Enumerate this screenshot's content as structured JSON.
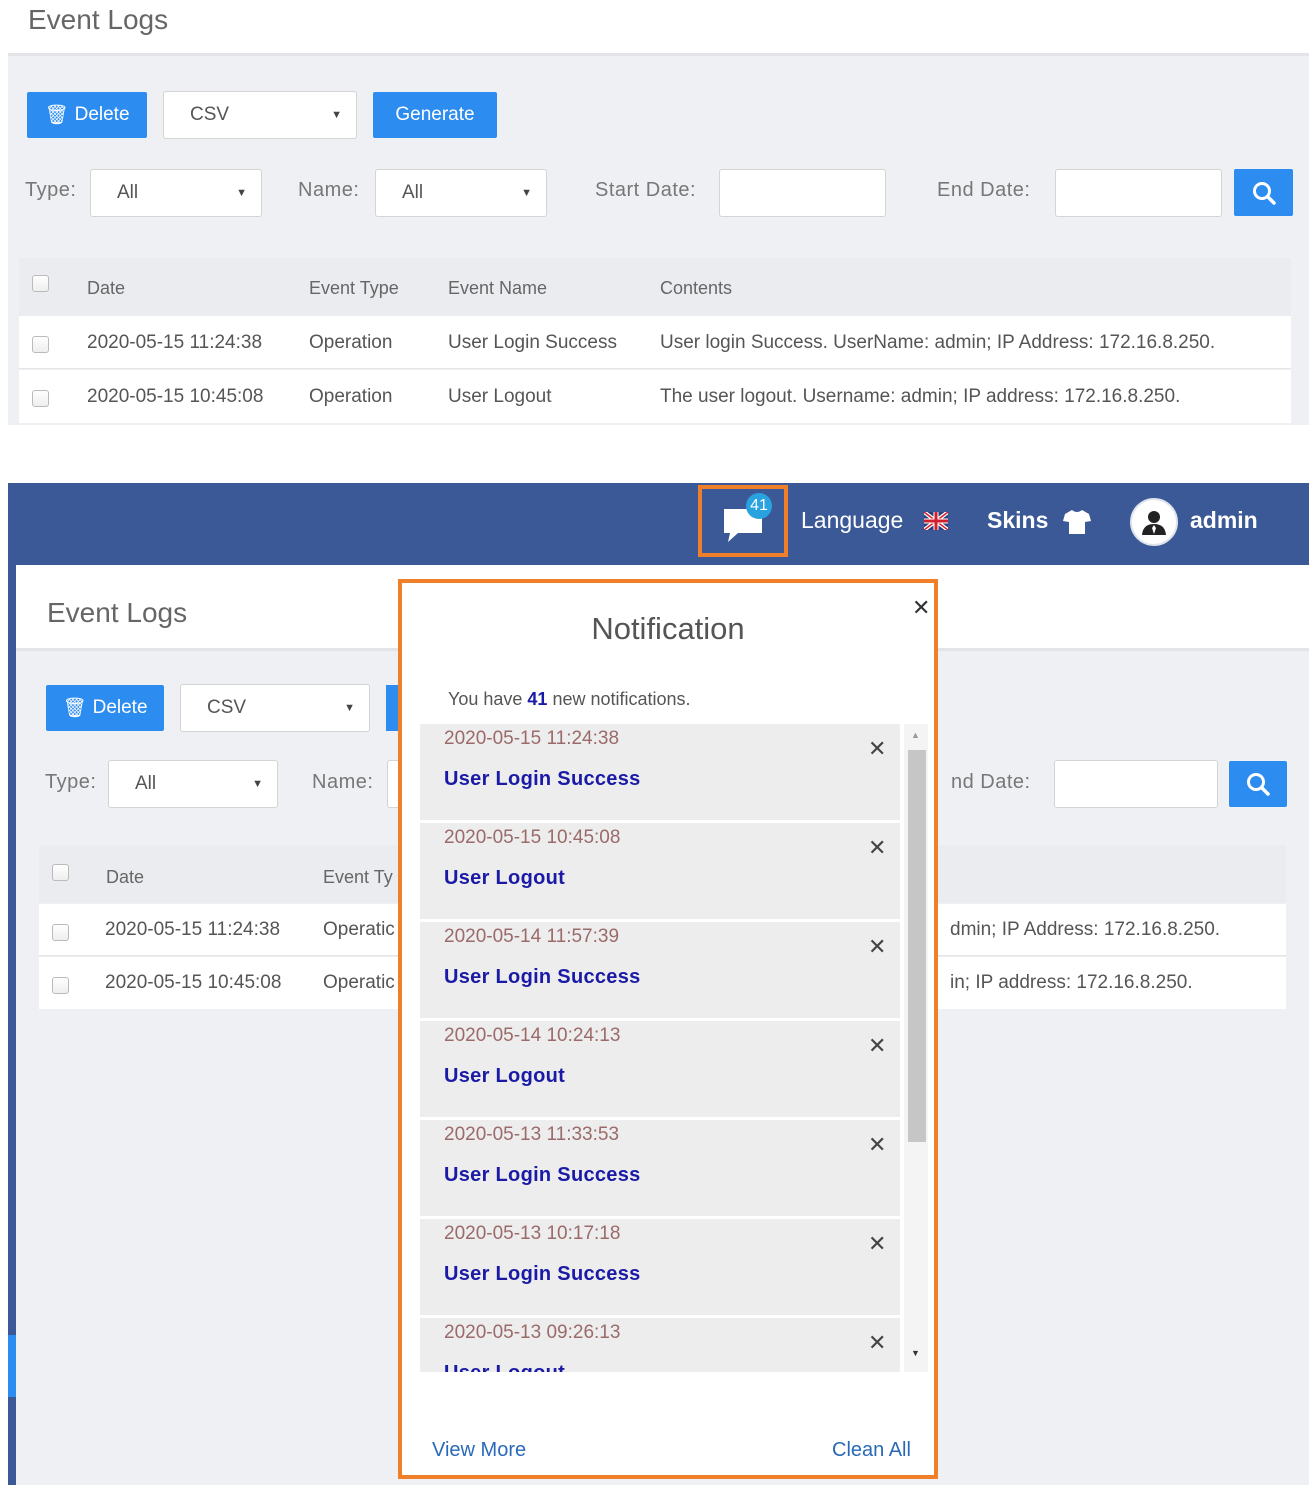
{
  "top": {
    "title": "Event Logs",
    "delete_label": "Delete",
    "format_value": "CSV",
    "generate_label": "Generate",
    "filters": {
      "type_label": "Type:",
      "type_value": "All",
      "name_label": "Name:",
      "name_value": "All",
      "start_label": "Start Date:",
      "start_value": "",
      "end_label": "End Date:",
      "end_value": ""
    },
    "table": {
      "headers": [
        "Date",
        "Event Type",
        "Event Name",
        "Contents"
      ],
      "rows": [
        [
          "2020-05-15 11:24:38",
          "Operation",
          "User Login Success",
          "User login Success. UserName: admin; IP Address: 172.16.8.250."
        ],
        [
          "2020-05-15 10:45:08",
          "Operation",
          "User Logout",
          "The user logout. Username: admin; IP address: 172.16.8.250."
        ]
      ]
    }
  },
  "navbar": {
    "notification_count": "41",
    "language_label": "Language",
    "skins_label": "Skins",
    "user_label": "admin"
  },
  "bottom": {
    "title": "Event Logs",
    "delete_label": "Delete",
    "format_value": "CSV",
    "type_label": "Type:",
    "type_value": "All",
    "name_label": "Name:",
    "end_label_partial": "nd Date:",
    "headers": [
      "Date",
      "Event Ty"
    ],
    "rows": [
      [
        "2020-05-15 11:24:38",
        "Operatic",
        "dmin; IP Address: 172.16.8.250."
      ],
      [
        "2020-05-15 10:45:08",
        "Operatic",
        "in; IP address: 172.16.8.250."
      ]
    ]
  },
  "notification": {
    "title": "Notification",
    "summary_prefix": "You have ",
    "summary_count": "41",
    "summary_suffix": " new notifications.",
    "close_glyph": "✕",
    "items": [
      {
        "date": "2020-05-15 11:24:38",
        "name": "User Login Success"
      },
      {
        "date": "2020-05-15 10:45:08",
        "name": "User Logout"
      },
      {
        "date": "2020-05-14 11:57:39",
        "name": "User Login Success"
      },
      {
        "date": "2020-05-14 10:24:13",
        "name": "User Logout"
      },
      {
        "date": "2020-05-13 11:33:53",
        "name": "User Login Success"
      },
      {
        "date": "2020-05-13 10:17:18",
        "name": "User Login Success"
      },
      {
        "date": "2020-05-13 09:26:13",
        "name": "User Logout"
      }
    ],
    "view_more_label": "View More",
    "clean_all_label": "Clean All"
  },
  "colors": {
    "primary": "#2d8cf0",
    "navbar": "#3b5997",
    "highlight_border": "#f07f2a",
    "notification_link": "#1a1aa6"
  }
}
